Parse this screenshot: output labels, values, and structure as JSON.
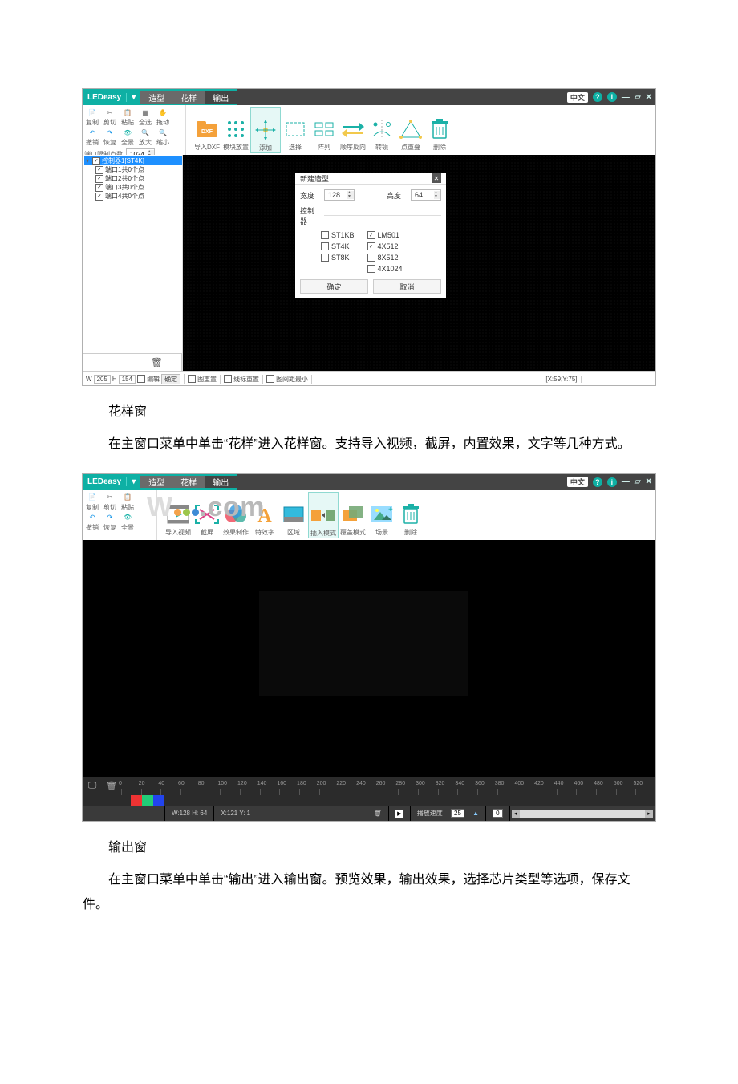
{
  "app_title": "LEDeasy",
  "menu": {
    "shape": "造型",
    "pattern": "花样",
    "output": "输出"
  },
  "header": {
    "lang": "中文"
  },
  "shot1": {
    "left_small": {
      "copy": "复制",
      "cut": "剪切",
      "paste": "粘贴",
      "selectall": "全选",
      "drag": "拖动",
      "undo": "撤销",
      "redo": "恢复",
      "reset": "全景",
      "zoomin": "放大",
      "zoomout": "缩小",
      "port_limit_label": "端口限制点数",
      "port_limit_value": "1024"
    },
    "big": [
      {
        "id": "import-dxf",
        "label": "导入DXF"
      },
      {
        "id": "module-place",
        "label": "模块放置"
      },
      {
        "id": "add",
        "label": "添加",
        "sel": true
      },
      {
        "id": "select",
        "label": "选择"
      },
      {
        "id": "array",
        "label": "阵列"
      },
      {
        "id": "reverse",
        "label": "顺序反向"
      },
      {
        "id": "mirror",
        "label": "转镜"
      },
      {
        "id": "overlap",
        "label": "点重叠"
      },
      {
        "id": "delete",
        "label": "删除"
      }
    ],
    "tree": {
      "root": "控制器1[ST4K]",
      "items": [
        "端口1共0个点",
        "端口2共0个点",
        "端口3共0个点",
        "端口4共0个点"
      ]
    },
    "dialog": {
      "title": "新建造型",
      "width_label": "宽度",
      "width": "128",
      "height_label": "高度",
      "height": "64",
      "controller_label": "控制器",
      "left": [
        "ST1KB",
        "ST4K",
        "ST8K"
      ],
      "right": [
        {
          "t": "LM501",
          "c": true
        },
        {
          "t": "4X512",
          "c": true
        },
        {
          "t": "8X512",
          "c": false
        },
        {
          "t": "4X1024",
          "c": false
        }
      ],
      "ok": "确定",
      "cancel": "取消"
    },
    "status": {
      "w": "W",
      "wv": "205",
      "h": "H",
      "hv": "154",
      "edit": "编辑",
      "confirm": "确定",
      "layer": "图重置",
      "line_layer": "线标重置",
      "layer_min": "图间距最小",
      "coord": "[X:59;Y:75]"
    }
  },
  "prose": {
    "h1": "花样窗",
    "p1": "在主窗口菜单中单击“花样”进入花样窗。支持导入视频，截屏，内置效果，文字等几种方式。",
    "h2": "输出窗",
    "p2": "在主窗口菜单中单击“输出”进入输出窗。预览效果，输出效果，选择芯片类型等选项，保存文件。"
  },
  "shot2": {
    "left_small": {
      "copy": "复制",
      "cut": "剪切",
      "paste": "粘贴",
      "undo": "撤销",
      "redo": "恢复",
      "reset": "全景"
    },
    "big": [
      {
        "id": "import-video",
        "label": "导入视频"
      },
      {
        "id": "screenshot",
        "label": "截屏"
      },
      {
        "id": "fx",
        "label": "效果制作"
      },
      {
        "id": "textfx",
        "label": "特效字"
      },
      {
        "id": "region",
        "label": "区域"
      },
      {
        "id": "insert-mode",
        "label": "插入模式",
        "sel": true
      },
      {
        "id": "overlay-mode",
        "label": "覆盖模式"
      },
      {
        "id": "scene",
        "label": "场景"
      },
      {
        "id": "delete",
        "label": "删除"
      }
    ],
    "timeline_ticks": [
      "0",
      "20",
      "40",
      "60",
      "80",
      "100",
      "120",
      "140",
      "160",
      "180",
      "200",
      "220",
      "240",
      "260",
      "280",
      "300",
      "320",
      "340",
      "360",
      "380",
      "400",
      "420",
      "440",
      "460",
      "480",
      "500",
      "520"
    ],
    "status": {
      "wh": "W:128 H: 64",
      "xy": "X:121 Y: 1",
      "speed_label": "播放速度",
      "speed": "25",
      "pos": "0"
    }
  },
  "watermark": {
    "pre": "W",
    "post": ".com"
  }
}
